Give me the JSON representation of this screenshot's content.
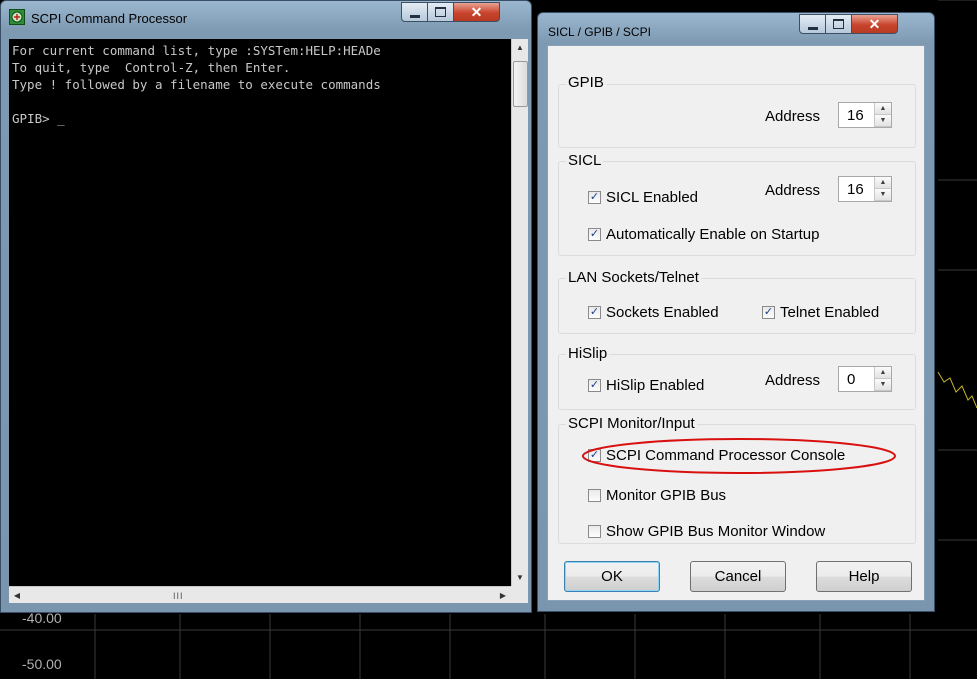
{
  "colors": {
    "highlight": "#d81010",
    "console_text": "#c8c8c8",
    "trace": "#c8b428"
  },
  "background": {
    "y_labels": [
      "-40.00",
      "-50.00"
    ]
  },
  "console": {
    "title": "SCPI Command Processor",
    "icon": "scpi-app-icon",
    "lines": [
      "For current command list, type :SYSTem:HELP:HEADe",
      "To quit, type  Control-Z, then Enter.",
      "Type ! followed by a filename to execute commands",
      "",
      "GPIB> _"
    ],
    "hscroll_grip": "III"
  },
  "dialog": {
    "title": "SICL / GPIB / SCPI",
    "gpib": {
      "label": "GPIB",
      "address_label": "Address",
      "address_value": "16"
    },
    "sicl": {
      "label": "SICL",
      "enabled_label": "SICL Enabled",
      "enabled": true,
      "address_label": "Address",
      "address_value": "16",
      "auto_enable_label": "Automatically Enable on Startup",
      "auto_enable": true
    },
    "lan": {
      "label": "LAN Sockets/Telnet",
      "sockets_label": "Sockets Enabled",
      "sockets": true,
      "telnet_label": "Telnet Enabled",
      "telnet": true
    },
    "hislip": {
      "label": "HiSlip",
      "enabled_label": "HiSlip Enabled",
      "enabled": true,
      "address_label": "Address",
      "address_value": "0"
    },
    "monitor": {
      "label": "SCPI Monitor/Input",
      "console_label": "SCPI Command Processor Console",
      "console": true,
      "monitor_gpib_label": "Monitor GPIB Bus",
      "monitor_gpib": false,
      "show_monitor_label": "Show GPIB Bus Monitor Window",
      "show_monitor": false
    },
    "buttons": {
      "ok": "OK",
      "cancel": "Cancel",
      "help": "Help"
    }
  }
}
